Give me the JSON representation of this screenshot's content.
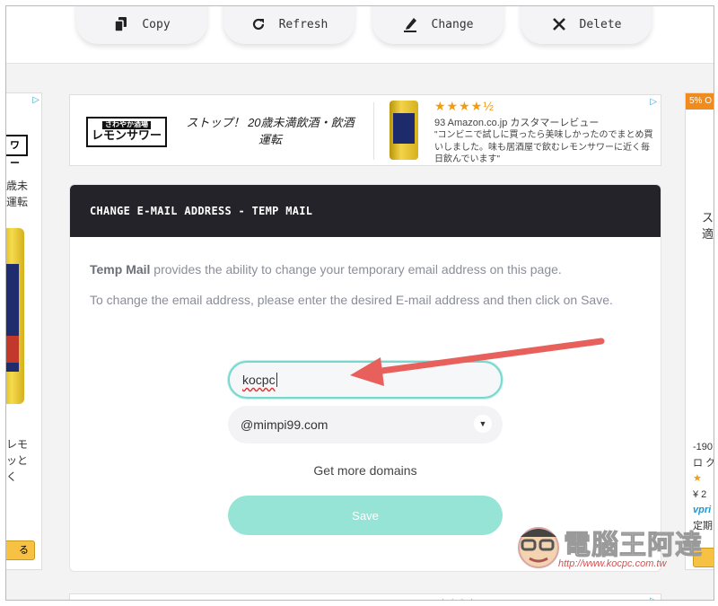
{
  "toolbar": {
    "copy_label": "Copy",
    "refresh_label": "Refresh",
    "change_label": "Change",
    "delete_label": "Delete"
  },
  "ad_top": {
    "brand_small": "さわやか酒場",
    "brand": "レモンサワー",
    "slogan": "ストップ！ 20歳未満飲酒・飲酒運転",
    "stars": "★★★★½",
    "rating": "93 Amazon.co.jp カスタマーレビュー",
    "review": "\"コンビニで試しに買ったら美味しかったのでまとめ買いしました。味も居酒屋で飲むレモンサワーに近く毎日飲んでいます\""
  },
  "side_left": {
    "label_top": "ワー",
    "text1": "歳未",
    "text2": "運転",
    "text3": "レモ",
    "text4": "ッと",
    "text5": "く",
    "button": "る"
  },
  "side_right": {
    "badge": "5% O",
    "text1": "ス",
    "text2": "適",
    "price": "-190",
    "text3": "ロ ク",
    "text4": "¥ 2",
    "text5": "vpri",
    "text6": "定期"
  },
  "card": {
    "title": "CHANGE E-MAIL ADDRESS - TEMP MAIL",
    "intro_bold": "Temp Mail",
    "intro_rest": " provides the ability to change your temporary email address on this page.",
    "instruction": "To change the email address, please enter the desired E-mail address and then click on Save.",
    "username_value": "kocpc",
    "domain_value": "@mimpi99.com",
    "more_domains": "Get more domains",
    "save_label": "Save"
  },
  "watermark": {
    "title": "電腦王阿達",
    "url": "http://www.kocpc.com.tw"
  },
  "colors": {
    "header_dark": "#232329",
    "accent_teal": "#96e4d5",
    "arrow_red": "#e8605c"
  }
}
